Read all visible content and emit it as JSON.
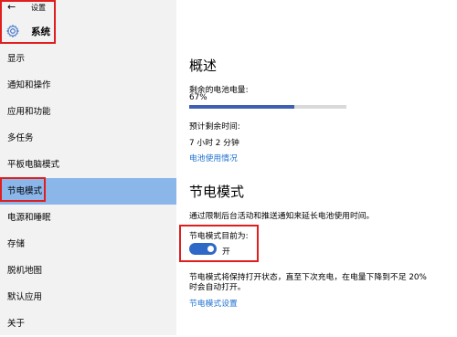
{
  "window": {
    "title": "设置"
  },
  "header": {
    "title": "系统"
  },
  "sidebar": {
    "items": [
      {
        "label": "显示"
      },
      {
        "label": "通知和操作"
      },
      {
        "label": "应用和功能"
      },
      {
        "label": "多任务"
      },
      {
        "label": "平板电脑模式"
      },
      {
        "label": "节电模式",
        "selected": true
      },
      {
        "label": "电源和睡眠"
      },
      {
        "label": "存储"
      },
      {
        "label": "脱机地图"
      },
      {
        "label": "默认应用"
      },
      {
        "label": "关于"
      }
    ]
  },
  "overview": {
    "title": "概述",
    "battery_label": "剩余的电池电量:",
    "battery_percent_text": "67%",
    "battery_level": 0.67,
    "remaining_label": "预计剩余时间:",
    "remaining_value": "7 小时 2 分钟",
    "usage_link": "电池使用情况"
  },
  "saver": {
    "title": "节电模式",
    "description": "通过限制后台活动和推送通知来延长电池使用时间。",
    "status_label": "节电模式目前为:",
    "toggle_state": "开",
    "toggle_on": true,
    "auto_line1": "节电模式将保持打开状态，直至下次充电，在电量下降到不足 20%",
    "auto_line2": "时会自动打开。",
    "settings_link": "节电模式设置"
  },
  "colors": {
    "accent": "#2f69c8",
    "selected_bg": "#8ab6ea",
    "link": "#1d6fd0",
    "highlight_box": "#e01e1e"
  },
  "icons": {
    "back": "back-arrow-icon",
    "system": "gear-icon"
  }
}
